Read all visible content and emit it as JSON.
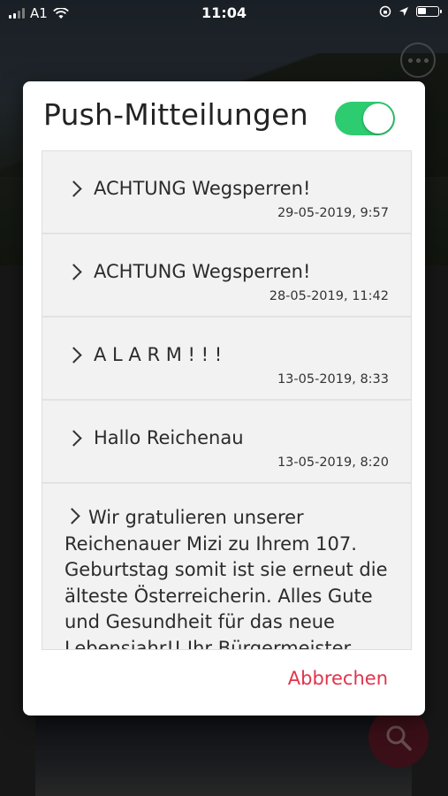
{
  "status_bar": {
    "carrier": "A1",
    "time": "11:04"
  },
  "dialog": {
    "title": "Push-Mitteilungen",
    "toggle_on": true,
    "cancel_label": "Abbrechen",
    "accent_color": "#e0344c",
    "toggle_color": "#2ecc71",
    "notifications": [
      {
        "title": "ACHTUNG Wegsperren!",
        "date": "29-05-2019, 9:57"
      },
      {
        "title": "ACHTUNG Wegsperren!",
        "date": "28-05-2019, 11:42"
      },
      {
        "title": "A L A R M ! ! !",
        "date": "13-05-2019, 8:33"
      },
      {
        "title": "Hallo Reichenau",
        "date": "13-05-2019, 8:20"
      }
    ],
    "long_message": "Wir gratulieren unserer Reichenauer Mizi zu Ihrem 107. Geburtstag somit ist sie erneut die älteste Österreicherin. Alles Gute und Gesundheit für das neue Lebensjahr!! Ihr Bürgermeister"
  },
  "icons": {
    "more": "more-dots-icon",
    "search": "search-icon",
    "chevron": "chevron-right-icon"
  }
}
